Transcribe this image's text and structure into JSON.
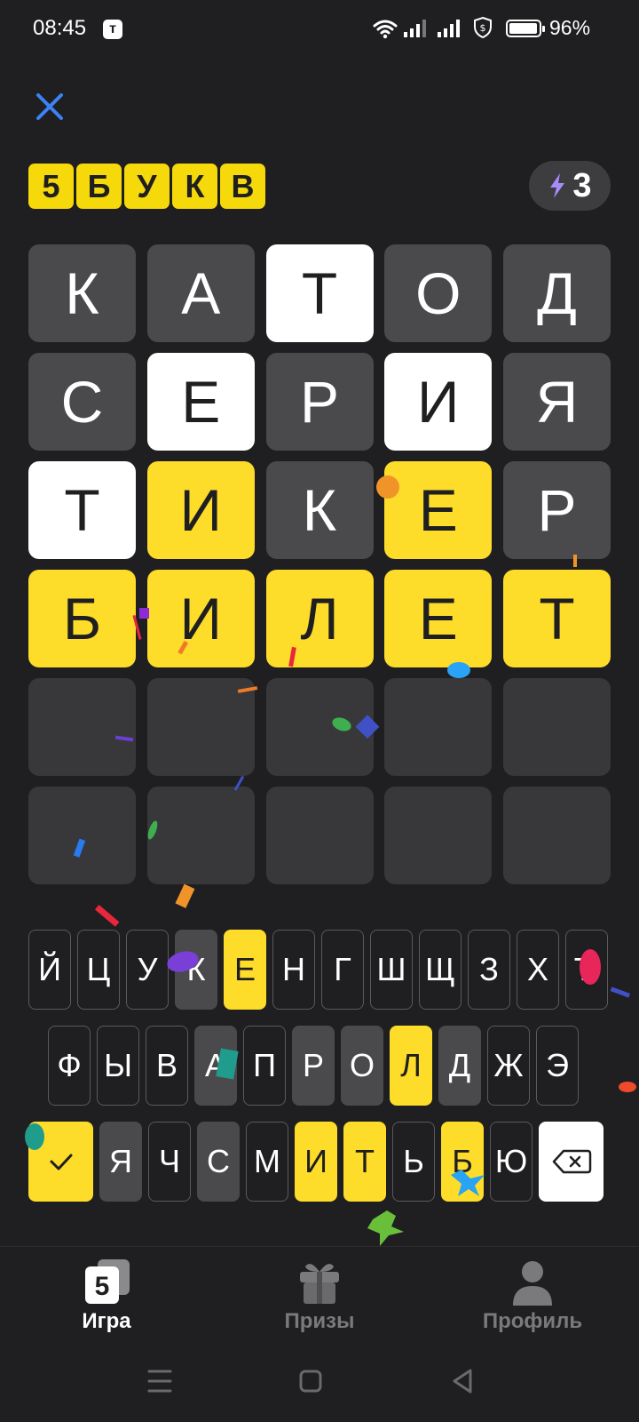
{
  "status_bar": {
    "time": "08:45",
    "app_badge": "т",
    "battery_pct": "96%",
    "battery_level": 0.96
  },
  "header": {
    "logo_letters": [
      "5",
      "Б",
      "У",
      "К",
      "В"
    ],
    "energy_count": "3"
  },
  "board": {
    "rows": [
      [
        {
          "l": "К",
          "s": "gray"
        },
        {
          "l": "А",
          "s": "gray"
        },
        {
          "l": "Т",
          "s": "white"
        },
        {
          "l": "О",
          "s": "gray"
        },
        {
          "l": "Д",
          "s": "gray"
        }
      ],
      [
        {
          "l": "С",
          "s": "gray"
        },
        {
          "l": "Е",
          "s": "white"
        },
        {
          "l": "Р",
          "s": "gray"
        },
        {
          "l": "И",
          "s": "white"
        },
        {
          "l": "Я",
          "s": "gray"
        }
      ],
      [
        {
          "l": "Т",
          "s": "white"
        },
        {
          "l": "И",
          "s": "yellow"
        },
        {
          "l": "К",
          "s": "gray"
        },
        {
          "l": "Е",
          "s": "yellow"
        },
        {
          "l": "Р",
          "s": "gray"
        }
      ],
      [
        {
          "l": "Б",
          "s": "yellow"
        },
        {
          "l": "И",
          "s": "yellow"
        },
        {
          "l": "Л",
          "s": "yellow"
        },
        {
          "l": "Е",
          "s": "yellow"
        },
        {
          "l": "Т",
          "s": "yellow"
        }
      ],
      [
        {
          "l": "",
          "s": "empty"
        },
        {
          "l": "",
          "s": "empty"
        },
        {
          "l": "",
          "s": "empty"
        },
        {
          "l": "",
          "s": "empty"
        },
        {
          "l": "",
          "s": "empty"
        }
      ],
      [
        {
          "l": "",
          "s": "empty"
        },
        {
          "l": "",
          "s": "empty"
        },
        {
          "l": "",
          "s": "empty"
        },
        {
          "l": "",
          "s": "empty"
        },
        {
          "l": "",
          "s": "empty"
        }
      ]
    ]
  },
  "keyboard": {
    "row1": [
      {
        "k": "Й",
        "s": "default"
      },
      {
        "k": "Ц",
        "s": "default"
      },
      {
        "k": "У",
        "s": "default"
      },
      {
        "k": "К",
        "s": "gray"
      },
      {
        "k": "Е",
        "s": "yellow"
      },
      {
        "k": "Н",
        "s": "default"
      },
      {
        "k": "Г",
        "s": "default"
      },
      {
        "k": "Ш",
        "s": "default"
      },
      {
        "k": "Щ",
        "s": "default"
      },
      {
        "k": "З",
        "s": "default"
      },
      {
        "k": "Х",
        "s": "default"
      },
      {
        "k": "Ъ",
        "s": "default"
      }
    ],
    "row2": [
      {
        "k": "Ф",
        "s": "default"
      },
      {
        "k": "Ы",
        "s": "default"
      },
      {
        "k": "В",
        "s": "default"
      },
      {
        "k": "А",
        "s": "gray"
      },
      {
        "k": "П",
        "s": "default"
      },
      {
        "k": "Р",
        "s": "gray"
      },
      {
        "k": "О",
        "s": "gray"
      },
      {
        "k": "Л",
        "s": "yellow"
      },
      {
        "k": "Д",
        "s": "gray"
      },
      {
        "k": "Ж",
        "s": "default"
      },
      {
        "k": "Э",
        "s": "default"
      }
    ],
    "row3": [
      {
        "k": "Я",
        "s": "gray"
      },
      {
        "k": "Ч",
        "s": "default"
      },
      {
        "k": "С",
        "s": "gray"
      },
      {
        "k": "М",
        "s": "default"
      },
      {
        "k": "И",
        "s": "yellow"
      },
      {
        "k": "Т",
        "s": "yellow"
      },
      {
        "k": "Ь",
        "s": "default"
      },
      {
        "k": "Б",
        "s": "yellow"
      },
      {
        "k": "Ю",
        "s": "default"
      }
    ],
    "enter_icon": "check-icon",
    "backspace_icon": "backspace-icon"
  },
  "bottom_nav": {
    "game": {
      "label": "Игра",
      "icon": "game-five-icon"
    },
    "prizes": {
      "label": "Призы",
      "icon": "gift-icon"
    },
    "profile": {
      "label": "Профиль",
      "icon": "user-icon"
    }
  },
  "colors": {
    "background": "#1f1f21",
    "absent": "#4a4a4d",
    "present": "#ffffff",
    "correct": "#fddc2a",
    "empty": "#38383b",
    "close_icon": "#3b82f6",
    "energy_bolt": "#a78bfa"
  }
}
